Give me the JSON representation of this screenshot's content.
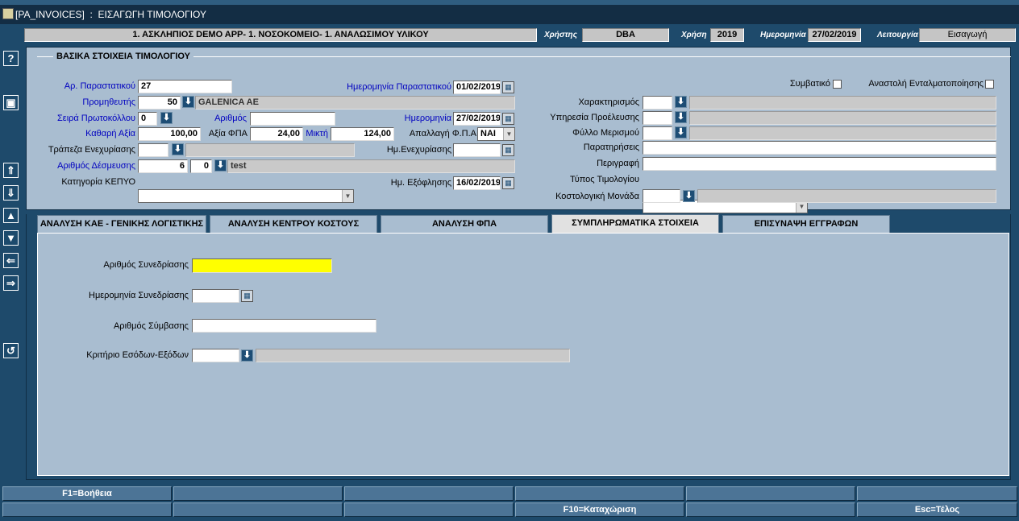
{
  "window": {
    "title": "[PA_INVOICES]  :  ΕΙΣΑΓΩΓΗ ΤΙΜΟΛΟΓΙΟΥ"
  },
  "header": {
    "org": "1. ΑΣΚΛΗΠΙΟΣ DEMO APP- 1. ΝΟΣΟΚΟΜΕΙΟ- 1. ΑΝΑΛΩΣΙΜΟΥ ΥΛΙΚΟΥ",
    "user_label": "Χρήστης",
    "user_value": "DBA",
    "year_label": "Χρήση",
    "year_value": "2019",
    "date_label": "Ημερομηνία",
    "date_value": "27/02/2019",
    "mode_label": "Λειτουργία",
    "mode_value": "Εισαγωγή"
  },
  "sidebar": {
    "icons": [
      "help-icon",
      "save-icon",
      "first-record-icon",
      "next-record-icon",
      "previous-block-icon",
      "next-block-icon",
      "previous-item-icon",
      "next-item-icon",
      "undo-icon"
    ]
  },
  "basic": {
    "title": "ΒΑΣΙΚΑ ΣΤΟΙΧΕΙΑ ΤΙΜΟΛΟΓΙΟΥ",
    "doc_no_label": "Αρ. Παραστατικού",
    "doc_no_value": "27",
    "doc_date_label": "Ημερομηνία Παραστατικού",
    "doc_date_value": "01/02/2019",
    "supplier_label": "Προμηθευτής",
    "supplier_code": "50",
    "supplier_name": "GALENICA AE",
    "protocol_series_label": "Σειρά Πρωτοκόλλου",
    "protocol_series_value": "0",
    "number_label": "Αριθμός",
    "number_value": "",
    "date_label": "Ημερομηνία",
    "date_value": "27/02/2019",
    "net_label": "Καθαρή Αξία",
    "net_value": "100,00",
    "vat_label": "Αξία ΦΠΑ",
    "vat_value": "24,00",
    "gross_label": "Μικτή",
    "gross_value": "124,00",
    "vat_exempt_label": "Απαλλαγή Φ.Π.Α",
    "vat_exempt_value": "ΝΑΙ",
    "pledge_bank_label": "Τράπεζα Ενεχυρίασης",
    "pledge_bank_code": "",
    "pledge_bank_name": "",
    "pledge_date_label": "Ημ.Ενεχυρίασης",
    "pledge_date_value": "",
    "commitment_label": "Αριθμός Δέσμευσης",
    "commitment_a": "6",
    "commitment_b": "0",
    "commitment_desc": "test",
    "kepyo_label": "Κατηγορία ΚΕΠΥΟ",
    "kepyo_value": "",
    "payment_date_label": "Ημ. Εξόφλησης",
    "payment_date_value": "16/02/2019",
    "contract_label": "Συμβατικό",
    "suspend_label": "Αναστολή Ενταλματοποίησης",
    "characterization_label": "Χαρακτηρισμός",
    "origin_service_label": "Υπηρεσία Προέλευσης",
    "allocation_sheet_label": "Φύλλο Μερισμού",
    "remarks_label": "Παρατηρήσεις",
    "description_label": "Περιγραφή",
    "invoice_type_label": "Τύπος Τιμολογίου",
    "cost_unit_label": "Κοστολογική Μονάδα"
  },
  "tabs": [
    {
      "label": "ΑΝΑΛΥΣΗ ΚΑΕ - ΓΕΝΙΚΗΣ ΛΟΓΙΣΤΙΚΗΣ"
    },
    {
      "label": "ΑΝΑΛΥΣΗ ΚΕΝΤΡΟΥ ΚΟΣΤΟΥΣ"
    },
    {
      "label": "ΑΝΑΛΥΣΗ ΦΠΑ"
    },
    {
      "label": "ΣΥΜΠΛΗΡΩΜΑΤΙΚΑ ΣΤΟΙΧΕΙΑ"
    },
    {
      "label": "ΕΠΙΣΥΝΑΨΗ ΕΓΓΡΑΦΩΝ"
    }
  ],
  "supplementary": {
    "meeting_no_label": "Αριθμός Συνεδρίασης",
    "meeting_no_value": "",
    "meeting_date_label": "Ημερομηνία Συνεδρίασης",
    "meeting_date_value": "",
    "contract_no_label": "Αριθμός Σύμβασης",
    "contract_no_value": "",
    "criterion_label": "Κριτήριο Εσόδων-Εξόδων",
    "criterion_code": "",
    "criterion_desc": ""
  },
  "function_keys": {
    "row1": [
      "F1=Βοήθεια",
      "",
      "",
      "",
      "",
      ""
    ],
    "row2": [
      "",
      "",
      "",
      "F10=Καταχώριση",
      "",
      "Esc=Τέλος"
    ]
  },
  "colors": {
    "background": "#1e4a6b",
    "panel": "#a9bdd0",
    "highlight": "#ffff00",
    "label_blue": "#0000c0"
  }
}
